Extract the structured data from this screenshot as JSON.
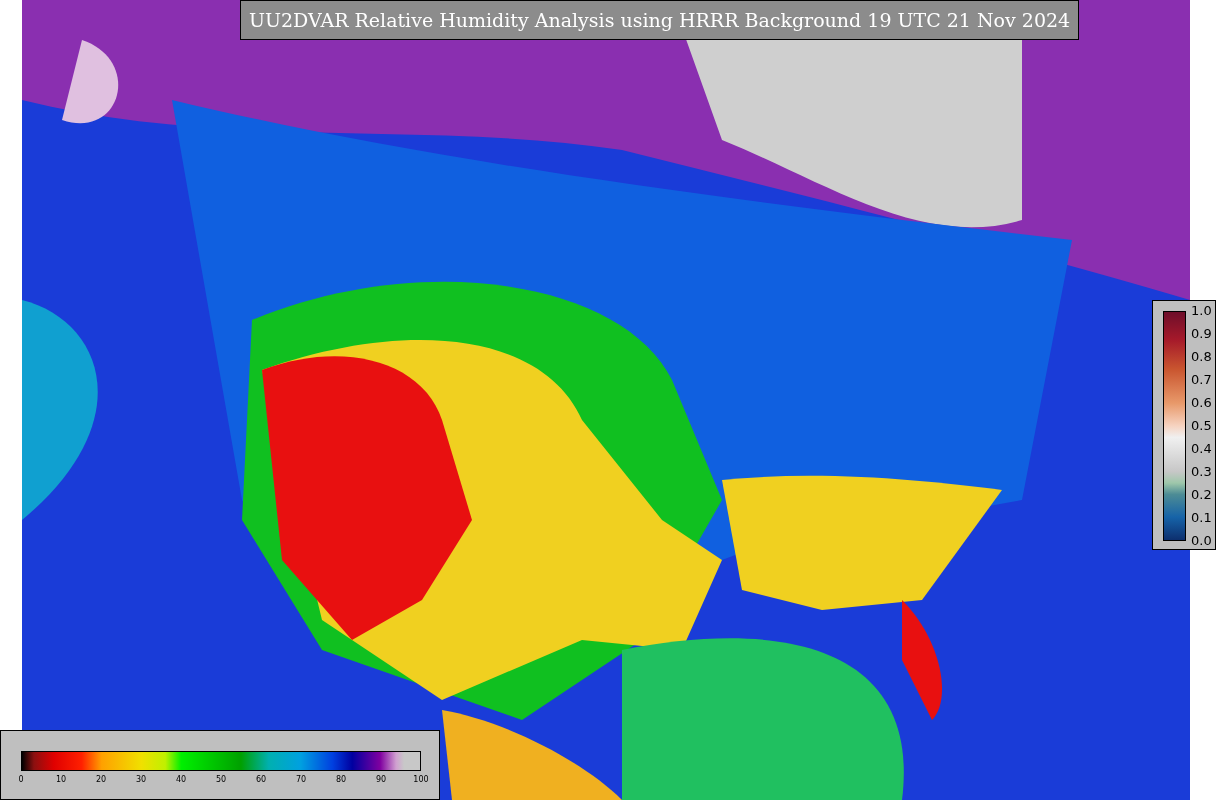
{
  "title": "UU2DVAR Relative Humidity Analysis using HRRR Background 19 UTC 21 Nov 2024",
  "ratio_colorbar": {
    "ticks": [
      "1.0",
      "0.9",
      "0.8",
      "0.7",
      "0.6",
      "0.5",
      "0.4",
      "0.3",
      "0.2",
      "0.1",
      "0.0"
    ]
  },
  "humidity_colorbar": {
    "ticks": [
      "0",
      "10",
      "20",
      "30",
      "40",
      "50",
      "60",
      "70",
      "80",
      "90",
      "100"
    ]
  }
}
